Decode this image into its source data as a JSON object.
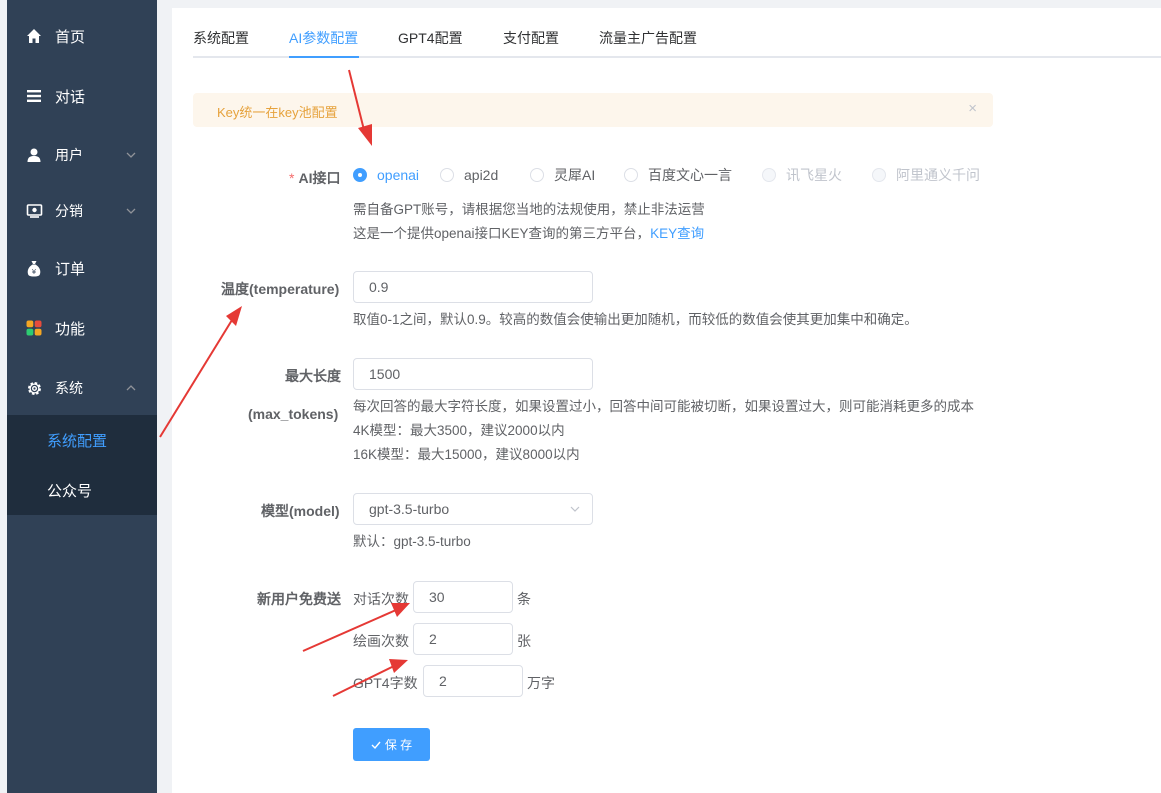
{
  "sidebar": {
    "items": [
      {
        "label": "首页",
        "icon": "home-icon"
      },
      {
        "label": "对话",
        "icon": "menu-lines-icon"
      },
      {
        "label": "用户",
        "icon": "user-icon"
      },
      {
        "label": "分销",
        "icon": "distribution-icon"
      },
      {
        "label": "订单",
        "icon": "money-bag-icon"
      },
      {
        "label": "功能",
        "icon": "grid-icon"
      },
      {
        "label": "系统",
        "icon": "gear-icon"
      }
    ],
    "submenu": [
      {
        "label": "系统配置",
        "active": true
      },
      {
        "label": "公众号",
        "active": false
      }
    ]
  },
  "tabs": [
    {
      "label": "系统配置"
    },
    {
      "label": "AI参数配置",
      "active": true
    },
    {
      "label": "GPT4配置"
    },
    {
      "label": "支付配置"
    },
    {
      "label": "流量主广告配置"
    }
  ],
  "alert": {
    "text": "Key统一在key池配置",
    "close": "×"
  },
  "ai_api": {
    "label": "AI接口",
    "required_mark": "*",
    "options": [
      {
        "label": "openai",
        "checked": true
      },
      {
        "label": "api2d"
      },
      {
        "label": "灵犀AI"
      },
      {
        "label": "百度文心一言"
      },
      {
        "label": "讯飞星火",
        "disabled": true
      },
      {
        "label": "阿里通义千问",
        "disabled": true
      }
    ],
    "help_line1": "需自备GPT账号，请根据您当地的法规使用，禁止非法运营",
    "help_line2": "这是一个提供openai接口KEY查询的第三方平台，",
    "help_link": "KEY查询"
  },
  "temperature": {
    "label": "温度(temperature)",
    "value": "0.9",
    "help": "取值0-1之间，默认0.9。较高的数值会使输出更加随机，而较低的数值会使其更加集中和确定。"
  },
  "max_tokens": {
    "label_line1": "最大长度",
    "label_line2": "(max_tokens)",
    "value": "1500",
    "help_line1": "每次回答的最大字符长度，如果设置过小，回答中间可能被切断，如果设置过大，则可能消耗更多的成本",
    "help_line2": "4K模型：最大3500，建议2000以内",
    "help_line3": "16K模型：最大15000，建议8000以内"
  },
  "model": {
    "label": "模型(model)",
    "value": "gpt-3.5-turbo",
    "help": "默认：gpt-3.5-turbo"
  },
  "free_gift": {
    "label": "新用户免费送",
    "chat": {
      "label": "对话次数",
      "value": "30",
      "unit": "条"
    },
    "draw": {
      "label": "绘画次数",
      "value": "2",
      "unit": "张"
    },
    "gpt4": {
      "label": "GPT4字数",
      "value": "2",
      "unit": "万字"
    }
  },
  "save_button": {
    "label": "保 存"
  },
  "colors": {
    "primary": "#409eff",
    "sidebar": "#304156",
    "submenu": "#1f2d3d",
    "warning": "#e6a23c",
    "annotation_arrow": "#e53935"
  }
}
